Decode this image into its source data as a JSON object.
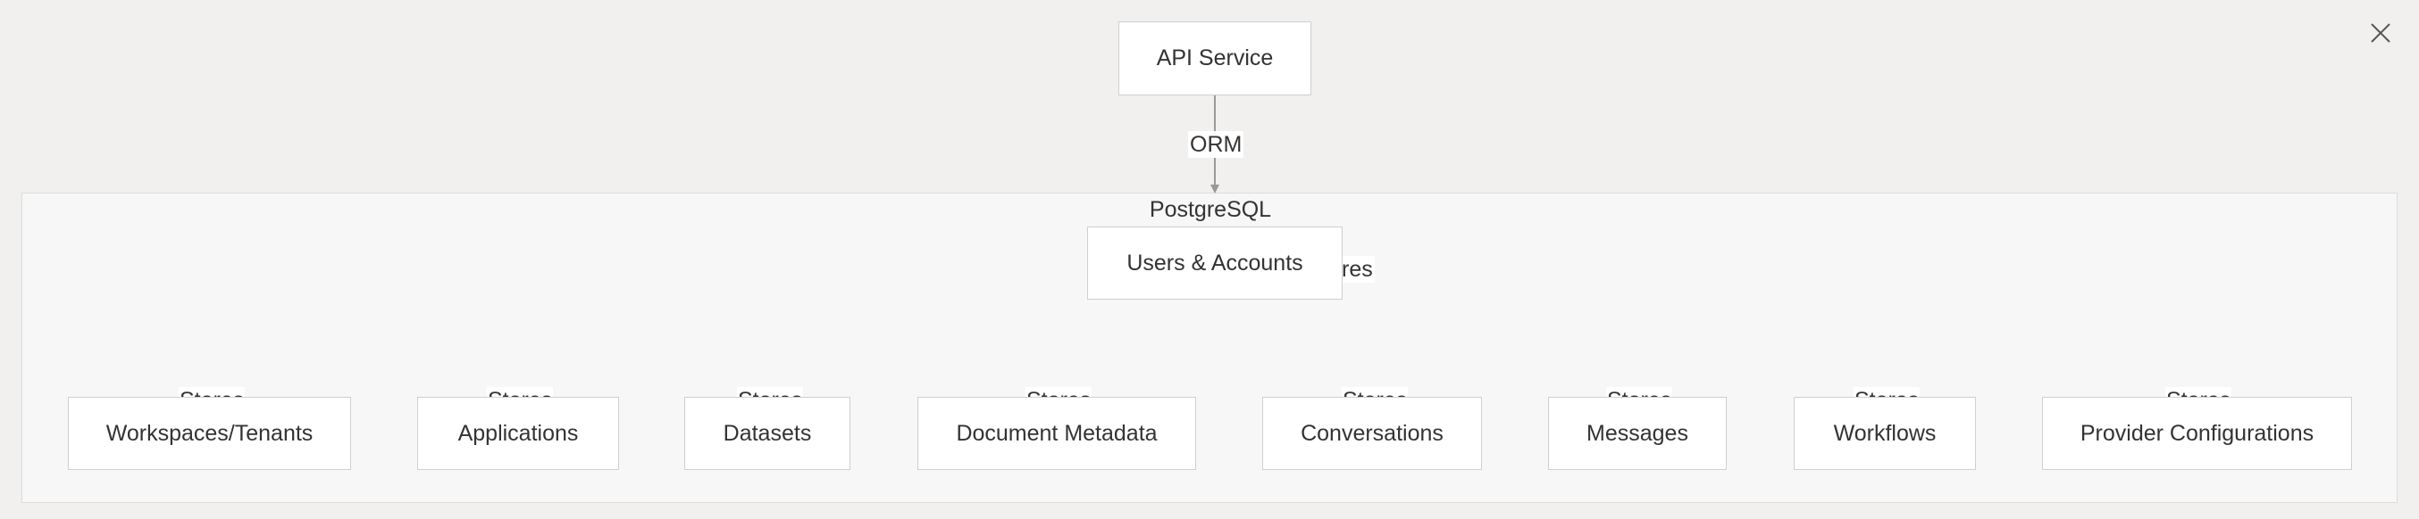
{
  "diagram": {
    "api_service": "API Service",
    "orm_label": "ORM",
    "database_label": "PostgreSQL",
    "users_accounts": "Users & Accounts",
    "partial_edge_label": "res",
    "stores_label": "Stores",
    "entities": [
      "Workspaces/Tenants",
      "Applications",
      "Datasets",
      "Document Metadata",
      "Conversations",
      "Messages",
      "Workflows",
      "Provider Configurations"
    ]
  },
  "icons": {
    "close": "close-icon"
  },
  "colors": {
    "background": "#f1f0ee",
    "cluster_fill": "#f7f7f7",
    "node_fill": "#ffffff",
    "node_border": "#cfcfcf",
    "edge": "#999999"
  }
}
